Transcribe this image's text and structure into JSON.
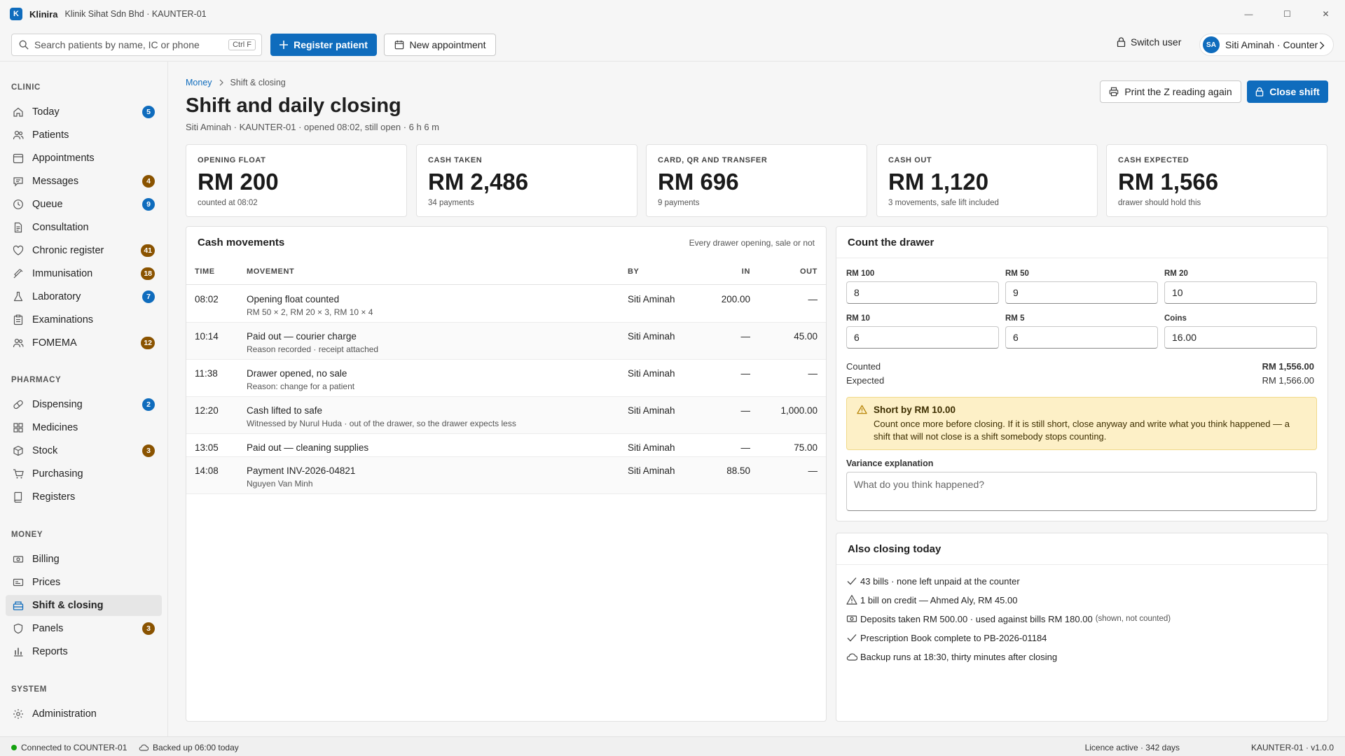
{
  "window": {
    "logo_letter": "K",
    "app_name": "Klinira",
    "subtitle": "Klinik Sihat Sdn Bhd · KAUNTER-01",
    "min": "—",
    "max": "☐",
    "close": "✕"
  },
  "toolbar": {
    "search_placeholder": "Search patients by name, IC or phone",
    "search_shortcut": "Ctrl F",
    "register_label": "Register patient",
    "new_appt_label": "New appointment",
    "switch_user_label": "Switch user",
    "user_initials": "SA",
    "user_label": "Siti Aminah · Counter"
  },
  "sidebar": {
    "clinic_title": "CLINIC",
    "clinic": [
      {
        "label": "Today",
        "badge": "5"
      },
      {
        "label": "Patients",
        "badge": ""
      },
      {
        "label": "Appointments",
        "badge": ""
      },
      {
        "label": "Messages",
        "badge": "4"
      },
      {
        "label": "Queue",
        "badge": "9"
      },
      {
        "label": "Consultation",
        "badge": ""
      },
      {
        "label": "Chronic register",
        "badge": "41"
      },
      {
        "label": "Immunisation",
        "badge": "18"
      },
      {
        "label": "Laboratory",
        "badge": "7"
      },
      {
        "label": "Examinations",
        "badge": ""
      },
      {
        "label": "FOMEMA",
        "badge": "12"
      }
    ],
    "pharmacy_title": "PHARMACY",
    "pharmacy": [
      {
        "label": "Dispensing",
        "badge": "2"
      },
      {
        "label": "Medicines",
        "badge": ""
      },
      {
        "label": "Stock",
        "badge": "3"
      },
      {
        "label": "Purchasing",
        "badge": ""
      },
      {
        "label": "Registers",
        "badge": ""
      }
    ],
    "money_title": "MONEY",
    "money": [
      {
        "label": "Billing",
        "badge": ""
      },
      {
        "label": "Prices",
        "badge": ""
      },
      {
        "label": "Shift & closing",
        "badge": ""
      },
      {
        "label": "Panels",
        "badge": "3"
      },
      {
        "label": "Reports",
        "badge": ""
      }
    ],
    "system_title": "SYSTEM",
    "system": [
      {
        "label": "Administration",
        "badge": ""
      }
    ]
  },
  "page": {
    "breadcrumb_root": "Money",
    "breadcrumb_current": "Shift & closing",
    "title": "Shift and daily closing",
    "subtitle": "Siti Aminah · KAUNTER-01 · opened 08:02, still open · 6 h 6 m",
    "print_label": "Print the Z reading again",
    "close_label": "Close shift"
  },
  "kpis": [
    {
      "label": "OPENING FLOAT",
      "value": "RM 200",
      "note": "counted at 08:02"
    },
    {
      "label": "CASH TAKEN",
      "value": "RM 2,486",
      "note": "34 payments"
    },
    {
      "label": "CARD, QR AND TRANSFER",
      "value": "RM 696",
      "note": "9 payments"
    },
    {
      "label": "CASH OUT",
      "value": "RM 1,120",
      "note": "3 movements, safe lift included"
    },
    {
      "label": "CASH EXPECTED",
      "value": "RM 1,566",
      "note": "drawer should hold this"
    }
  ],
  "movements": {
    "title": "Cash movements",
    "hint": "Every drawer opening, sale or not",
    "headers": {
      "time": "TIME",
      "movement": "MOVEMENT",
      "by": "BY",
      "in": "IN",
      "out": "OUT"
    },
    "rows": [
      {
        "time": "08:02",
        "title": "Opening float counted",
        "sub": "RM 50 × 2, RM 20 × 3, RM 10 × 4",
        "by": "Siti Aminah",
        "in": "200.00",
        "out": "—"
      },
      {
        "time": "10:14",
        "title": "Paid out — courier charge",
        "sub": "Reason recorded · receipt attached",
        "by": "Siti Aminah",
        "in": "—",
        "out": "45.00"
      },
      {
        "time": "11:38",
        "title": "Drawer opened, no sale",
        "sub": "Reason: change for a patient",
        "by": "Siti Aminah",
        "in": "—",
        "out": "—"
      },
      {
        "time": "12:20",
        "title": "Cash lifted to safe",
        "sub": "Witnessed by Nurul Huda · out of the drawer, so the drawer expects less",
        "by": "Siti Aminah",
        "in": "—",
        "out": "1,000.00"
      },
      {
        "time": "13:05",
        "title": "Paid out — cleaning supplies",
        "sub": "",
        "by": "Siti Aminah",
        "in": "—",
        "out": "75.00"
      },
      {
        "time": "14:08",
        "title": "Payment INV-2026-04821",
        "sub": "Nguyen Van Minh",
        "by": "Siti Aminah",
        "in": "88.50",
        "out": "—"
      }
    ]
  },
  "count": {
    "title": "Count the drawer",
    "denoms": [
      {
        "label": "RM 100",
        "value": "8"
      },
      {
        "label": "RM 50",
        "value": "9"
      },
      {
        "label": "RM 20",
        "value": "10"
      },
      {
        "label": "RM 10",
        "value": "6"
      },
      {
        "label": "RM 5",
        "value": "6"
      },
      {
        "label": "Coins",
        "value": "16.00"
      }
    ],
    "counted_label": "Counted",
    "counted_value": "RM 1,556.00",
    "expected_label": "Expected",
    "expected_value": "RM 1,566.00",
    "warning_title": "Short by RM 10.00",
    "warning_text": "Count once more before closing. If it is still short, close anyway and write what you think happened — a shift that will not close is a shift somebody stops counting.",
    "variance_label": "Variance explanation",
    "variance_placeholder": "What do you think happened?"
  },
  "also": {
    "title": "Also closing today",
    "items": [
      {
        "icon": "check-icon",
        "text": "43 bills · none left unpaid at the counter",
        "muted": ""
      },
      {
        "icon": "warning-icon",
        "text": "1 bill on credit — Ahmed Aly, RM 45.00",
        "muted": ""
      },
      {
        "icon": "money-icon",
        "text": "Deposits taken RM 500.00 · used against bills RM 180.00",
        "muted": "(shown, not counted)"
      },
      {
        "icon": "check-icon",
        "text": "Prescription Book complete to PB-2026-01184",
        "muted": ""
      },
      {
        "icon": "cloud-icon",
        "text": "Backup runs at 18:30, thirty minutes after closing",
        "muted": ""
      }
    ]
  },
  "status": {
    "connected": "Connected to COUNTER-01",
    "backup": "Backed up 06:00 today",
    "licence": "Licence active · 342 days",
    "version": "KAUNTER-01 · v1.0.0"
  },
  "colors": {
    "accent": "#0f6cbd",
    "badge_brown": "#8a5300",
    "warning_bg": "#fdf0c7",
    "status_ok": "#13a10e"
  }
}
